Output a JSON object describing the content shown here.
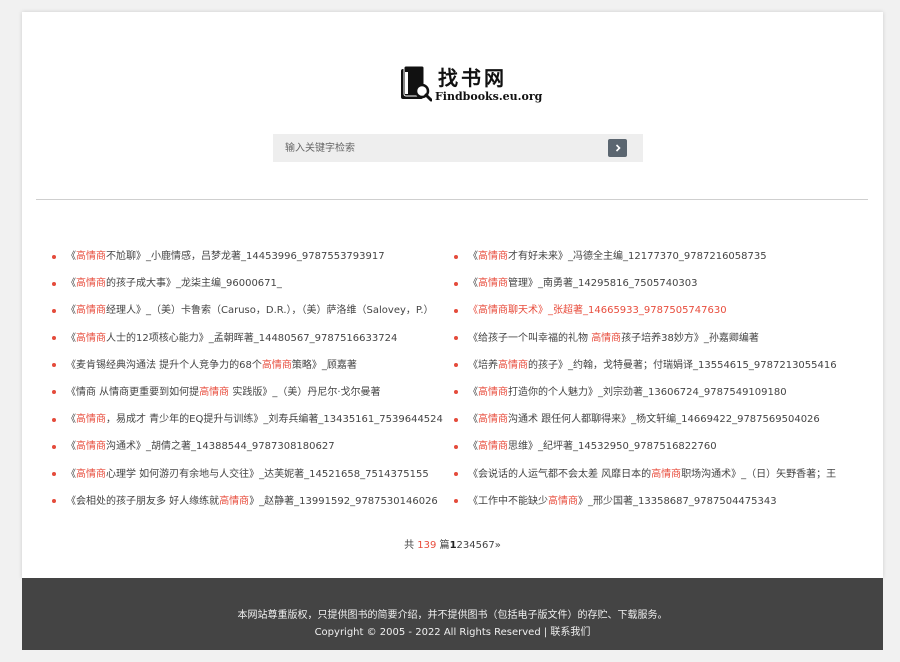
{
  "header": {
    "logo_title": "找书网",
    "logo_domain": "Findbooks.eu.org"
  },
  "search": {
    "placeholder": "输入关键字检索",
    "button_icon": "chevron-right-icon"
  },
  "keyword": "高情商",
  "results_left": [
    {
      "pre": "《",
      "kw": "高情商",
      "post": "不尬聊》_小鹿情感，吕梦龙著_14453996_9787553793917"
    },
    {
      "pre": "《",
      "kw": "高情商",
      "post": "的孩子成大事》_龙柒主编_96000671_"
    },
    {
      "pre": "《",
      "kw": "高情商",
      "post": "经理人》_（美）卡鲁索（Caruso，D.R.），（美）萨洛维（Salovey，P.）"
    },
    {
      "pre": "《",
      "kw": "高情商",
      "post": "人士的12项核心能力》_孟朝晖著_14480567_9787516633724"
    },
    {
      "pre": "《麦肯锡经典沟通法 提升个人竞争力的68个",
      "kw": "高情商",
      "post": "策略》_顾嘉著"
    },
    {
      "pre": "《情商 从情商更重要到如何提",
      "kw": "高情商",
      "post": " 实践版》_（美）丹尼尔·戈尔曼著"
    },
    {
      "pre": "《",
      "kw": "高情商",
      "post": "，易成才 青少年的EQ提升与训练》_刘寿兵编著_13435161_7539644524"
    },
    {
      "pre": "《",
      "kw": "高情商",
      "post": "沟通术》_胡倩之著_14388544_9787308180627"
    },
    {
      "pre": "《",
      "kw": "高情商",
      "post": "心理学 如何游刃有余地与人交往》_达芙妮著_14521658_7514375155"
    },
    {
      "pre": "《会相处的孩子朋友多 好人缘练就",
      "kw": "高情商",
      "post": "》_赵静著_13991592_9787530146026"
    }
  ],
  "results_right": [
    {
      "pre": "《",
      "kw": "高情商",
      "post": "才有好未来》_冯德全主编_12177370_9787216058735"
    },
    {
      "pre": "《",
      "kw": "高情商",
      "post": "管理》_南勇著_14295816_7505740303"
    },
    {
      "pre": "《",
      "kw": "高情商",
      "post": "聊天术》_张超著_14665933_9787505747630",
      "active": true
    },
    {
      "pre": "《给孩子一个叫幸福的礼物 ",
      "kw": "高情商",
      "post": "孩子培养38妙方》_孙嘉卿编著"
    },
    {
      "pre": "《培养",
      "kw": "高情商",
      "post": "的孩子》_约翰，戈特曼著；付瑞娟译_13554615_9787213055416"
    },
    {
      "pre": "《",
      "kw": "高情商",
      "post": "打造你的个人魅力》_刘宗劲著_13606724_9787549109180"
    },
    {
      "pre": "《",
      "kw": "高情商",
      "post": "沟通术 跟任何人都聊得来》_杨文轩编_14669422_9787569504026"
    },
    {
      "pre": "《",
      "kw": "高情商",
      "post": "思维》_纪坪著_14532950_9787516822760"
    },
    {
      "pre": "《会说话的人运气都不会太差 风靡日本的",
      "kw": "高情商",
      "post": "职场沟通术》_（日）矢野香著；王"
    },
    {
      "pre": "《工作中不能缺少",
      "kw": "高情商",
      "post": "》_邢少国著_13358687_9787504475343"
    }
  ],
  "pager": {
    "prefix": "共 ",
    "count": "139",
    "unit": " 篇",
    "current": "1",
    "pages": [
      "2",
      "3",
      "4",
      "5",
      "6",
      "7"
    ],
    "next": "»"
  },
  "footer": {
    "line1": "本网站尊重版权，只提供图书的简要介绍，并不提供图书（包括电子版文件）的存贮、下载服务。",
    "line2_copyright": "Copyright © 2005 - 2022 All Rights Reserved | ",
    "contact_link": "联系我们"
  },
  "colors": {
    "accent": "#e84d3d",
    "footer_bg": "#444444",
    "search_bg": "#eeeeee",
    "button_bg": "#5b6670"
  }
}
